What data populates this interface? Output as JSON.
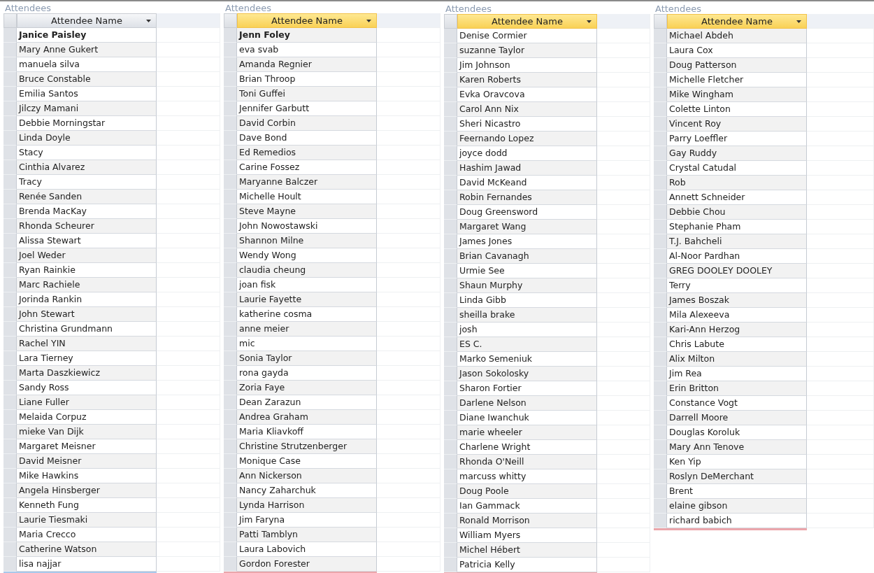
{
  "panels": [
    {
      "title": "Attendees",
      "header": {
        "label": "Attendee Name",
        "selected": false
      },
      "current_row_bold": true,
      "first_row_shaded": false,
      "new_row_selected": true,
      "rows": [
        "Janice Paisley",
        "Mary Anne Gukert",
        "manuela silva",
        "Bruce Constable",
        "Emilia Santos",
        "Jilczy Mamani",
        "Debbie Morningstar",
        "Linda Doyle",
        "Stacy",
        "Cinthia Alvarez",
        "Tracy",
        "Renée Sanden",
        "Brenda MacKay",
        "Rhonda Scheurer",
        "Alissa Stewart",
        "Joel Weder",
        "Ryan Rainkie",
        "Marc Rachiele",
        "Jorinda Rankin",
        "John Stewart",
        "Christina Grundmann",
        "Rachel YIN",
        "Lara Tierney",
        "Marta Daszkiewicz",
        "Sandy Ross",
        "Liane Fuller",
        "Melaida Corpuz",
        "mieke Van Dijk",
        "Margaret Meisner",
        "David Meisner",
        "Mike Hawkins",
        "Angela Hinsberger",
        "Kenneth Fung",
        "Laurie Tiesmaki",
        "Maria Crecco",
        "Catherine Watson",
        "lisa najjar"
      ]
    },
    {
      "title": "Attendees",
      "header": {
        "label": "Attendee Name",
        "selected": true
      },
      "current_row_bold": true,
      "first_row_shaded": true,
      "new_row_selected": false,
      "rows": [
        "Jenn Foley",
        "eva svab",
        "Amanda Regnier",
        "Brian Throop",
        "Toni Guffei",
        "Jennifer Garbutt",
        "David Corbin",
        "Dave Bond",
        "Ed Remedios",
        "Carine Fossez",
        "Maryanne  Balczer",
        "Michelle Hoult",
        "Steve Mayne",
        "John Nowostawski",
        "Shannon Milne",
        "Wendy Wong",
        "claudia cheung",
        "joan fisk",
        "Laurie Fayette",
        "katherine cosma",
        "anne meier",
        "mic",
        "Sonia Taylor",
        "rona gayda",
        "Zoria Faye",
        "Dean Zarazun",
        "Andrea Graham",
        "Maria Kliavkoff",
        "Christine Strutzenberger",
        "Monique Case",
        "Ann Nickerson",
        "Nancy Zaharchuk",
        "Lynda Harrison",
        "Jim Faryna",
        "Patti Tamblyn",
        "Laura Labovich",
        "Gordon Forester"
      ]
    },
    {
      "title": "Attendees",
      "header": {
        "label": "Attendee Name",
        "selected": true
      },
      "current_row_bold": false,
      "first_row_shaded": false,
      "new_row_selected": false,
      "rows": [
        "Denise Cormier",
        "suzanne Taylor",
        "Jim Johnson",
        "Karen Roberts",
        "Evka Oravcova",
        "Carol Ann Nix",
        "Sheri Nicastro",
        "Feernando Lopez",
        "joyce dodd",
        "Hashim Jawad",
        "David McKeand",
        "Robin Fernandes",
        "Doug Greensword",
        "Margaret Wang",
        "James Jones",
        "Brian Cavanagh",
        "Urmie See",
        "Shaun Murphy",
        "Linda Gibb",
        "sheilla brake",
        "josh",
        "ES C.",
        "Marko Semeniuk",
        "Jason Sokolosky",
        "Sharon Fortier",
        "Darlene Nelson",
        "Diane Iwanchuk",
        "marie wheeler",
        "Charlene Wright",
        "Rhonda O'Neill",
        "marcuss whitty",
        "Doug Poole",
        "Ian Gammack",
        "Ronald Morrison",
        "William Myers",
        "Michel Hébert",
        "Patricia Kelly"
      ]
    },
    {
      "title": "Attendees",
      "header": {
        "label": "Attendee Name",
        "selected": true
      },
      "current_row_bold": false,
      "first_row_shaded": true,
      "new_row_selected": false,
      "rows": [
        "Michael Abdeh",
        "Laura Cox",
        "Doug Patterson",
        "Michelle Fletcher",
        "Mike Wingham",
        "Colette Linton",
        "Vincent Roy",
        "Parry Loeffler",
        "Gay Ruddy",
        "Crystal Catudal",
        "Rob",
        "Annett Schneider",
        "Debbie Chou",
        "Stephanie Pham",
        "T.J. Bahcheli",
        "Al-Noor Pardhan",
        "GREG DOOLEY DOOLEY",
        "Terry",
        "James Boszak",
        "Mila Alexeeva",
        "Kari-Ann Herzog",
        "Chris Labute",
        "Alix Milton",
        "Jim Rea",
        "Erin Britton",
        "Constance Vogt",
        "Darrell Moore",
        "Douglas Koroluk",
        "Mary Ann Tenove",
        "Ken Yip",
        "Roslyn DeMerchant",
        "Brent",
        "elaine gibson",
        "richard babich"
      ]
    }
  ]
}
